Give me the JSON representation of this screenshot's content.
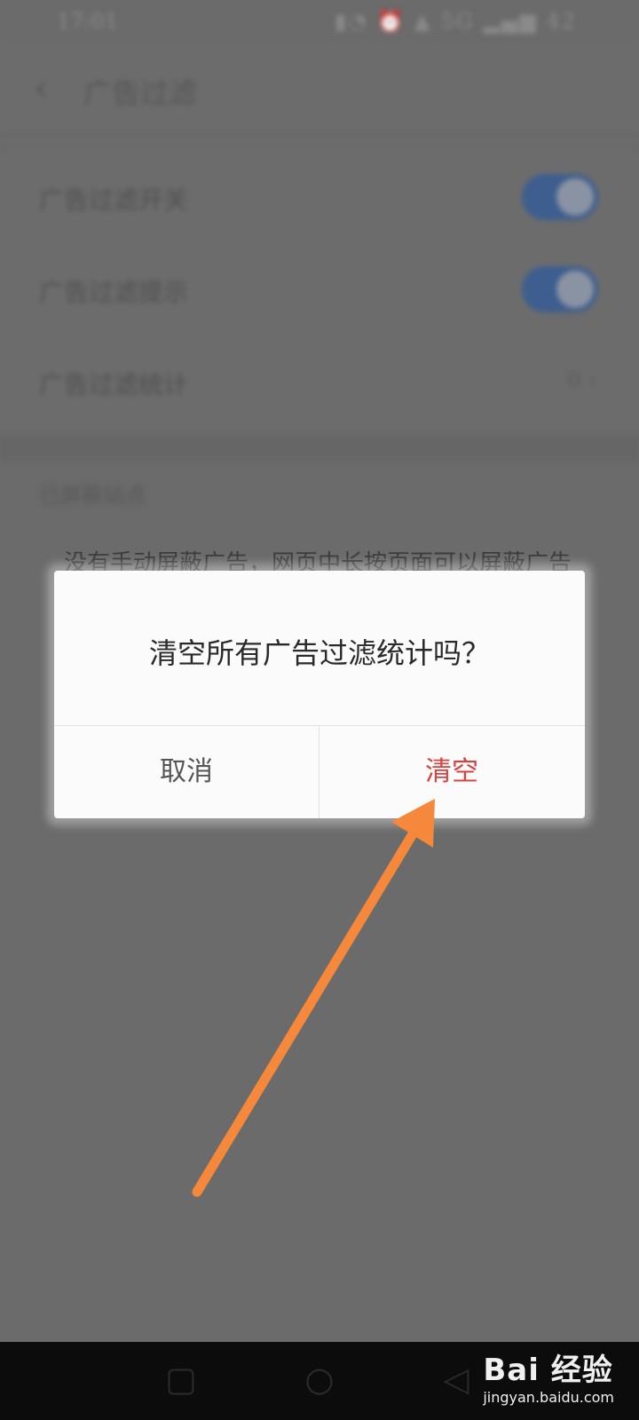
{
  "status_bar": {
    "time": "17:01",
    "indicators": "▮◔ ⏰ ▲ 5G ▂▄▆ 42"
  },
  "header": {
    "back_icon": "‹",
    "title": "广告过滤"
  },
  "settings": {
    "rows": [
      {
        "label": "广告过滤开关",
        "toggle_on": true
      },
      {
        "label": "广告过滤提示",
        "toggle_on": true
      },
      {
        "label": "广告过滤统计",
        "value": "0 ›"
      }
    ],
    "section_title": "已屏蔽站点",
    "empty_hint": "没有手动屏蔽广告，网页中长按页面可以屏蔽广告"
  },
  "dialog": {
    "message": "清空所有广告过滤统计吗？",
    "cancel_label": "取消",
    "confirm_label": "清空",
    "confirm_color": "#d94040"
  },
  "annotation": {
    "arrow_color": "#f5883a"
  },
  "watermark": {
    "brand": "Bai 经验",
    "site": "jingyan.baidu.com"
  }
}
